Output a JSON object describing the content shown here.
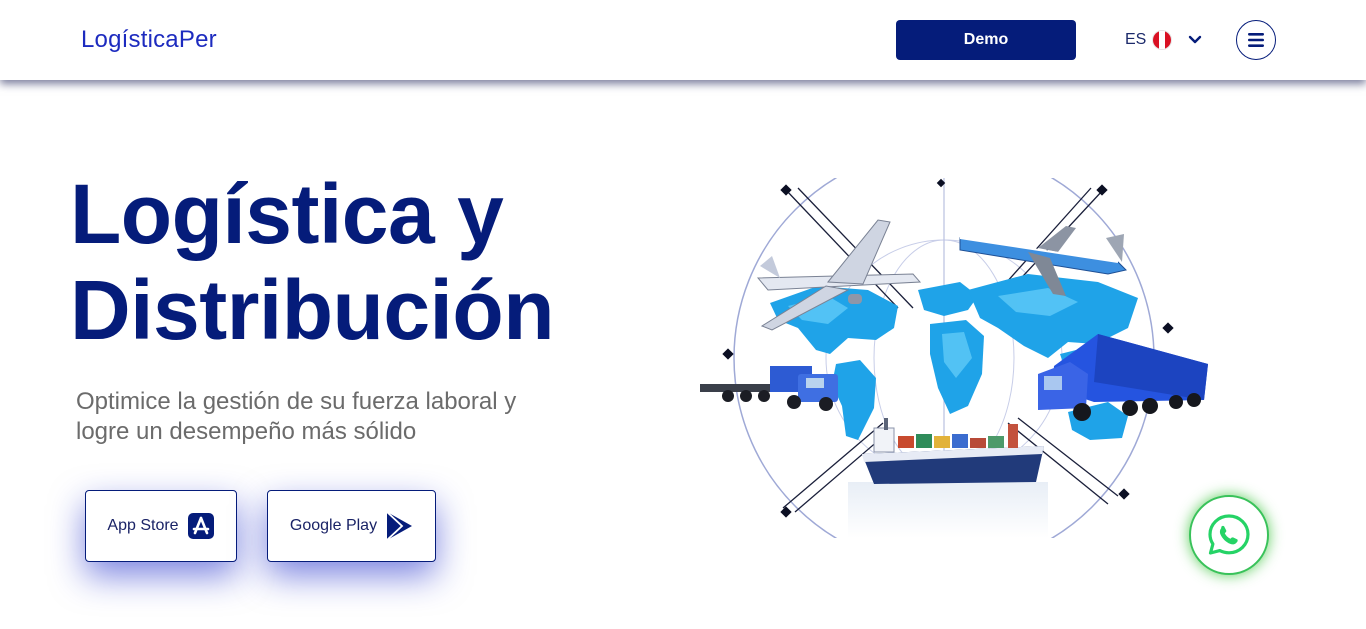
{
  "header": {
    "logo": "LogísticaPer",
    "demo_label": "Demo",
    "language": {
      "code": "ES",
      "flag_icon": "peru-flag-icon",
      "flag_colors": [
        "#d91023",
        "#ffffff",
        "#d91023"
      ]
    },
    "menu_icon": "hamburger-menu-icon"
  },
  "hero": {
    "title_line1": "Logística y",
    "title_line2": "Distribución",
    "subtitle": "Optimice la gestión de su fuerza laboral y logre un desempeño más sólido"
  },
  "stores": {
    "app_store_label": "App Store",
    "app_store_icon": "app-store-icon",
    "google_play_label": "Google Play",
    "google_play_icon": "google-play-icon"
  },
  "illustration": {
    "description_icon": "logistics-world-map-illustration"
  },
  "whatsapp": {
    "icon": "whatsapp-icon",
    "color": "#25d366"
  },
  "colors": {
    "brand": "#051c7a",
    "logo": "#1d2bbf",
    "subtitle": "#6b6b6b"
  }
}
